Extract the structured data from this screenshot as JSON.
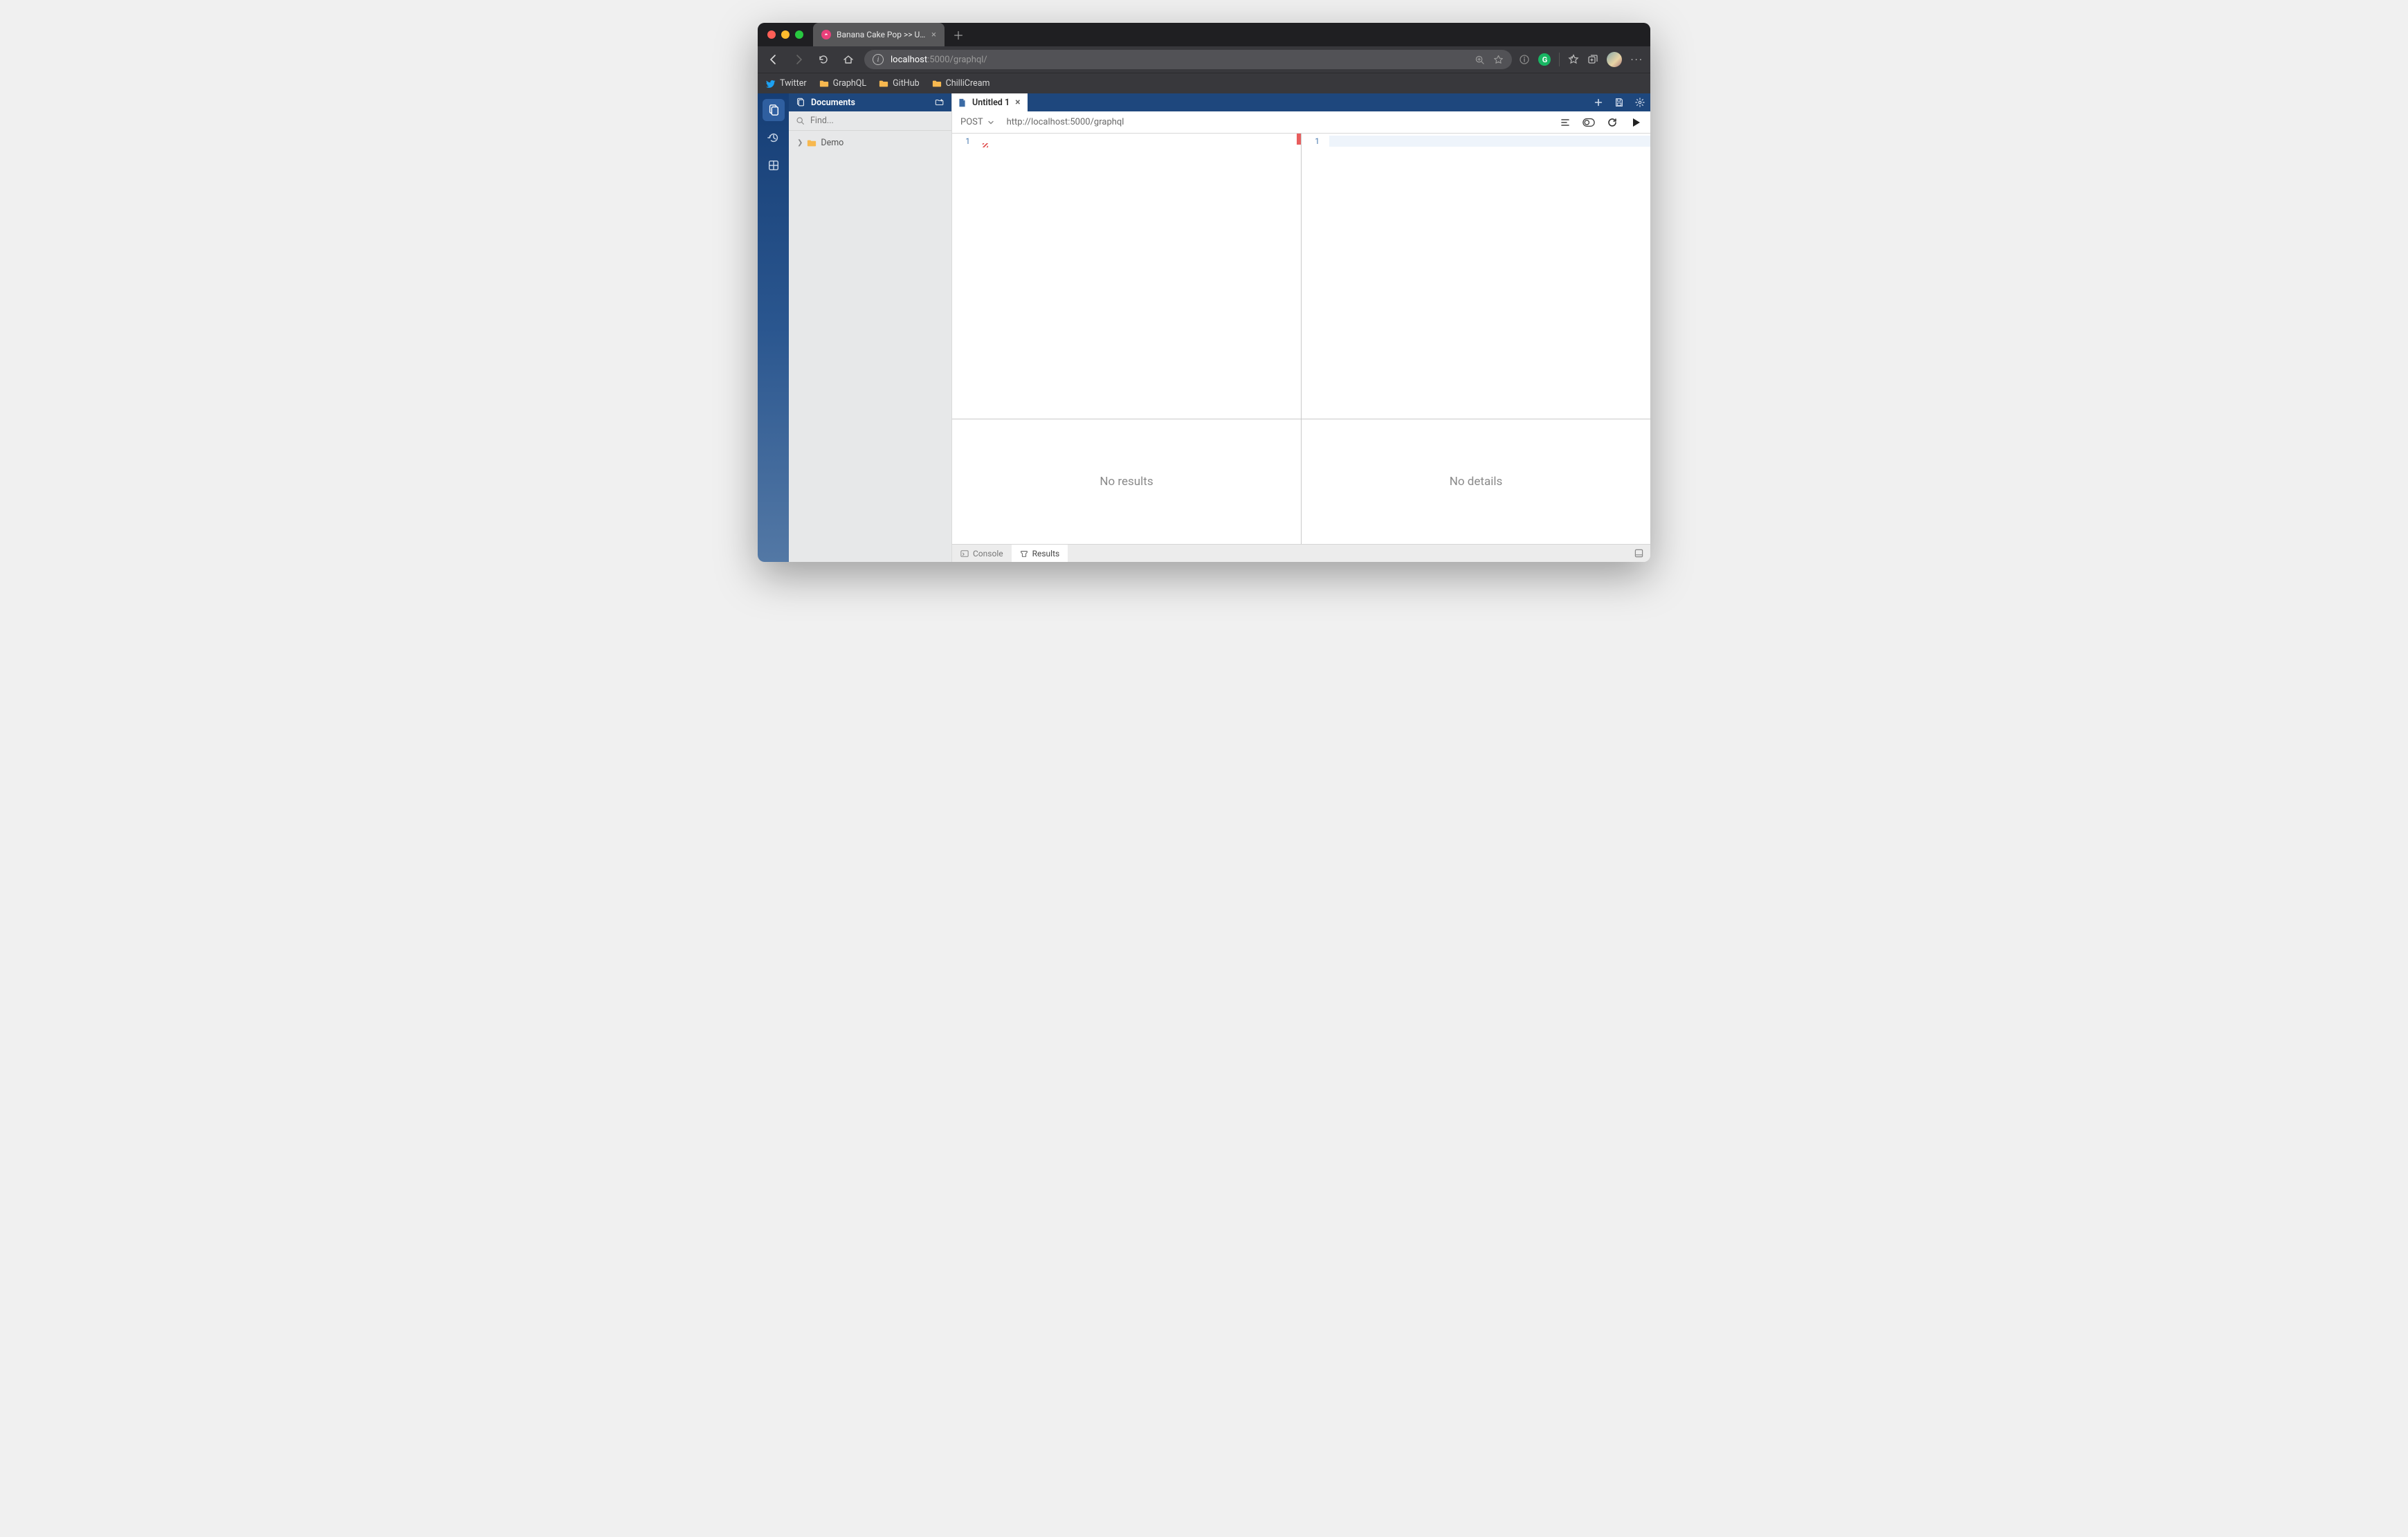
{
  "browser": {
    "tab_title": "Banana Cake Pop >> Untitled 1",
    "address_host": "localhost",
    "address_port_path": ":5000/graphql/",
    "bookmarks": [
      "Twitter",
      "GraphQL",
      "GitHub",
      "ChilliCream"
    ]
  },
  "side": {
    "header": "Documents",
    "find_placeholder": "Find...",
    "tree_item": "Demo"
  },
  "tabs": {
    "active": "Untitled 1"
  },
  "request": {
    "method": "POST",
    "url": "http://localhost:5000/graphql"
  },
  "editors": {
    "left_line": "1",
    "right_line": "1"
  },
  "bottom": {
    "left_msg": "No results",
    "right_msg": "No details"
  },
  "status": {
    "console": "Console",
    "results": "Results"
  }
}
